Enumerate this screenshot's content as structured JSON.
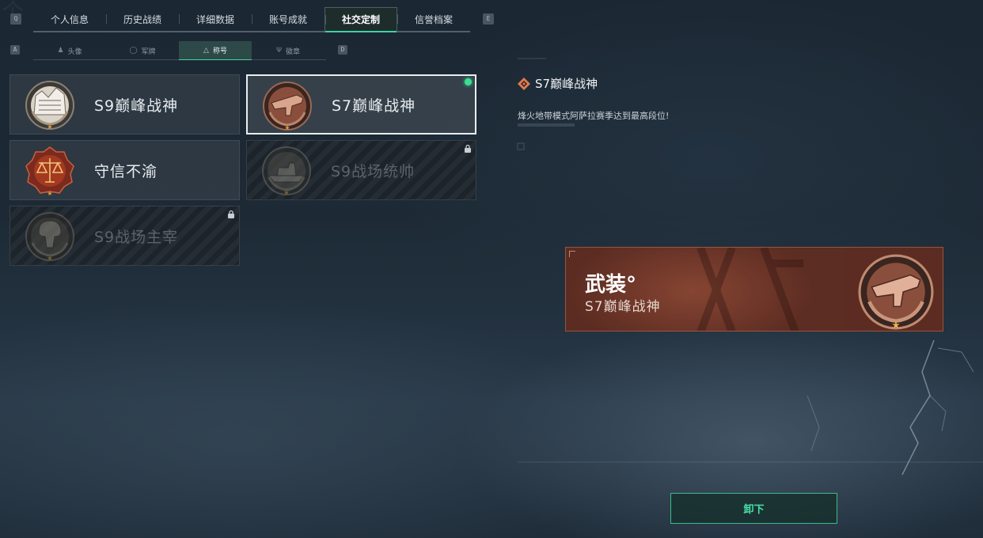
{
  "top_tabs": {
    "items": [
      {
        "label": "个人信息"
      },
      {
        "label": "历史战绩"
      },
      {
        "label": "详细数据"
      },
      {
        "label": "账号成就"
      },
      {
        "label": "社交定制",
        "active": true
      },
      {
        "label": "信誉档案"
      }
    ],
    "left_key": "Q",
    "right_key": "E"
  },
  "sub_tabs": {
    "items": [
      {
        "label": "头像",
        "icon": "person-icon"
      },
      {
        "label": "军牌",
        "icon": "dogtag-icon"
      },
      {
        "label": "称号",
        "icon": "title-icon",
        "active": true
      },
      {
        "label": "徽章",
        "icon": "badge-icon"
      }
    ],
    "left_key": "A",
    "right_key": "D"
  },
  "titles": [
    {
      "label": "S9巅峰战神",
      "locked": false,
      "emblem": "fortress-emblem"
    },
    {
      "label": "S7巅峰战神",
      "locked": false,
      "selected": true,
      "equipped": true,
      "emblem": "gun-emblem"
    },
    {
      "label": "守信不渝",
      "locked": false,
      "emblem": "scales-emblem"
    },
    {
      "label": "S9战场统帅",
      "locked": true,
      "emblem": "warship-emblem"
    },
    {
      "label": "S9战场主宰",
      "locked": true,
      "emblem": "mushroom-cloud-emblem"
    }
  ],
  "detail": {
    "title": "S7巅峰战神",
    "description": "烽火地带模式阿萨拉赛季达到最高段位!"
  },
  "preview": {
    "category": "武装°",
    "name": "S7巅峰战神"
  },
  "unequip_label": "卸下",
  "colors": {
    "accent": "#3fd39c",
    "equipped_dot": "#39e08f",
    "preview_bg": "#6b3528",
    "title_icon": "#e07a4f"
  }
}
